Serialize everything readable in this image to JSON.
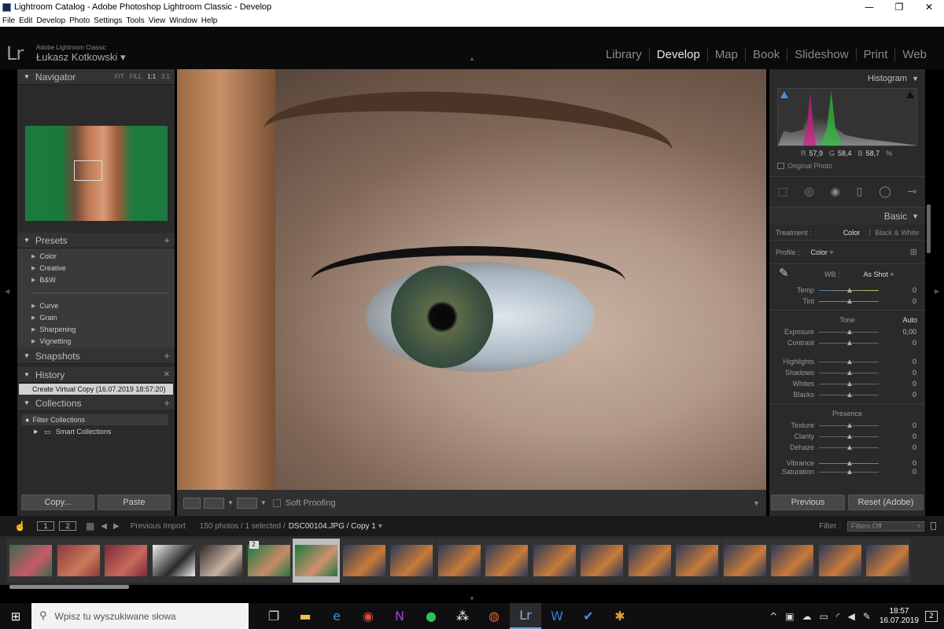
{
  "window": {
    "title": "Lightroom Catalog - Adobe Photoshop Lightroom Classic - Develop",
    "minimize": "—",
    "maximize": "❐",
    "close": "✕"
  },
  "menu": [
    "File",
    "Edit",
    "Develop",
    "Photo",
    "Settings",
    "Tools",
    "View",
    "Window",
    "Help"
  ],
  "identity": {
    "logo": "Lr",
    "app_name": "Adobe Lightroom Classic",
    "user": "Łukasz Kotkowski",
    "modules": [
      "Library",
      "Develop",
      "Map",
      "Book",
      "Slideshow",
      "Print",
      "Web"
    ],
    "active_module": "Develop"
  },
  "left": {
    "navigator": {
      "title": "Navigator",
      "zoom": [
        "FIT",
        "FILL",
        "1:1",
        "3:1"
      ],
      "active_zoom": "1:1"
    },
    "presets": {
      "title": "Presets",
      "groups1": [
        "Color",
        "Creative",
        "B&W"
      ],
      "groups2": [
        "Curve",
        "Grain",
        "Sharpening",
        "Vignetting"
      ]
    },
    "snapshots": {
      "title": "Snapshots"
    },
    "history": {
      "title": "History",
      "item": "Create Virtual Copy (16.07.2019 18:57:20)"
    },
    "collections": {
      "title": "Collections",
      "filter": "Filter Collections",
      "smart": "Smart Collections"
    },
    "copy_label": "Copy...",
    "paste_label": "Paste"
  },
  "softproof": {
    "label": "Soft Proofing"
  },
  "right": {
    "histogram": {
      "title": "Histogram",
      "r_label": "R",
      "r": "57,9",
      "g_label": "G",
      "g": "58,4",
      "b_label": "B",
      "b": "58,7",
      "unit": "%",
      "original": "Original Photo"
    },
    "basic": {
      "title": "Basic",
      "treatment_label": "Treatment :",
      "treatment_color": "Color",
      "treatment_bw": "Black & White",
      "profile_label": "Profile :",
      "profile_value": "Color ÷",
      "wb_label": "WB :",
      "wb_value": "As Shot ÷",
      "temp": {
        "label": "Temp",
        "value": "0"
      },
      "tint": {
        "label": "Tint",
        "value": "0"
      },
      "tone_label": "Tone",
      "auto_label": "Auto",
      "exposure": {
        "label": "Exposure",
        "value": "0,00"
      },
      "contrast": {
        "label": "Contrast",
        "value": "0"
      },
      "highlights": {
        "label": "Highlights",
        "value": "0"
      },
      "shadows": {
        "label": "Shadows",
        "value": "0"
      },
      "whites": {
        "label": "Whites",
        "value": "0"
      },
      "blacks": {
        "label": "Blacks",
        "value": "0"
      },
      "presence_label": "Presence",
      "texture": {
        "label": "Texture",
        "value": "0"
      },
      "clarity": {
        "label": "Clarity",
        "value": "0"
      },
      "dehaze": {
        "label": "Dehaze",
        "value": "0"
      },
      "vibrance": {
        "label": "Vibrance",
        "value": "0"
      },
      "saturation": {
        "label": "Saturation",
        "value": "0"
      }
    },
    "previous_label": "Previous",
    "reset_label": "Reset (Adobe)"
  },
  "filmbar": {
    "one": "1",
    "two": "2",
    "source": "Previous Import",
    "count": "150 photos / 1 selected /",
    "file": "DSC00104.JPG / Copy 1",
    "filter_label": "Filter :",
    "filter_value": "Filters Off"
  },
  "filmstrip": {
    "badge": "2",
    "thumbs": [
      {
        "c1": "#3a6a4a",
        "c2": "#c85a6a"
      },
      {
        "c1": "#8a3a3a",
        "c2": "#c87a5a"
      },
      {
        "c1": "#7a2a3a",
        "c2": "#c86a5a"
      },
      {
        "c1": "#f0f0f0",
        "c2": "#2a2a2a"
      },
      {
        "c1": "#2a2a2a",
        "c2": "#c8b0a0"
      },
      {
        "c1": "#1a7a3e",
        "c2": "#c88a6a"
      },
      {
        "c1": "#1a7a3e",
        "c2": "#d09070"
      },
      {
        "c1": "#2a3a5a",
        "c2": "#c87a3a"
      },
      {
        "c1": "#2a3a5a",
        "c2": "#c87a3a"
      },
      {
        "c1": "#2a3a5a",
        "c2": "#c87a3a"
      },
      {
        "c1": "#2a3a5a",
        "c2": "#c87a3a"
      },
      {
        "c1": "#2a3a5a",
        "c2": "#c87a3a"
      },
      {
        "c1": "#2a3a5a",
        "c2": "#c87a3a"
      },
      {
        "c1": "#2a3a5a",
        "c2": "#c87a3a"
      },
      {
        "c1": "#2a3a5a",
        "c2": "#c87a3a"
      },
      {
        "c1": "#2a3a5a",
        "c2": "#c87a3a"
      },
      {
        "c1": "#2a3a5a",
        "c2": "#c87a3a"
      },
      {
        "c1": "#2a3a5a",
        "c2": "#c87a3a"
      },
      {
        "c1": "#2a3a5a",
        "c2": "#c87a3a"
      },
      {
        "c1": "#2a3a5a",
        "c2": "#c87a3a"
      }
    ]
  },
  "taskbar": {
    "search_placeholder": "Wpisz tu wyszukiwane słowa",
    "time": "18:57",
    "date": "16.07.2019",
    "notifications": "2"
  }
}
